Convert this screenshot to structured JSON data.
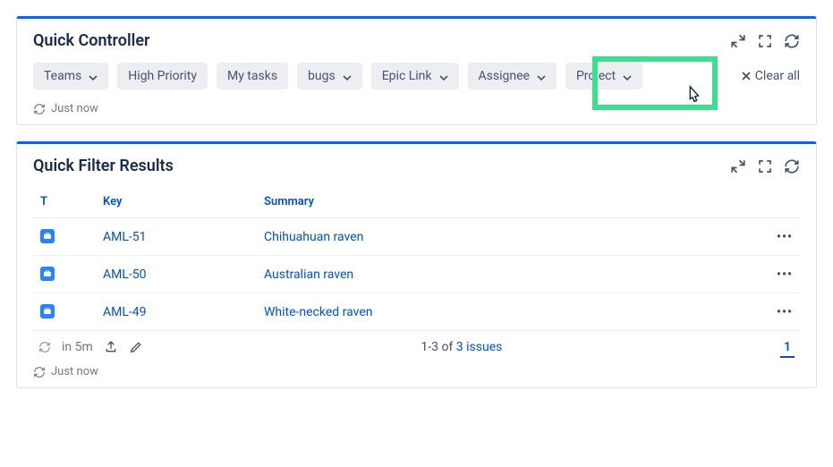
{
  "controller": {
    "title": "Quick Controller",
    "chips": {
      "teams": "Teams",
      "high_priority": "High Priority",
      "my_tasks": "My tasks",
      "bugs": "bugs",
      "epic_link": "Epic Link",
      "assignee": "Assignee",
      "project": "Project"
    },
    "clear_all": "Clear all",
    "refresh_text": "Just now"
  },
  "results": {
    "title": "Quick Filter Results",
    "columns": {
      "t": "T",
      "key": "Key",
      "summary": "Summary"
    },
    "rows": [
      {
        "key": "AML-51",
        "summary": "Chihuahuan raven"
      },
      {
        "key": "AML-50",
        "summary": "Australian raven"
      },
      {
        "key": "AML-49",
        "summary": "White-necked raven"
      }
    ],
    "footer": {
      "refresh_in": "in 5m",
      "count_text_pre": "1-3 of ",
      "count_link": "3 issues",
      "page": "1"
    },
    "refresh_text": "Just now"
  }
}
